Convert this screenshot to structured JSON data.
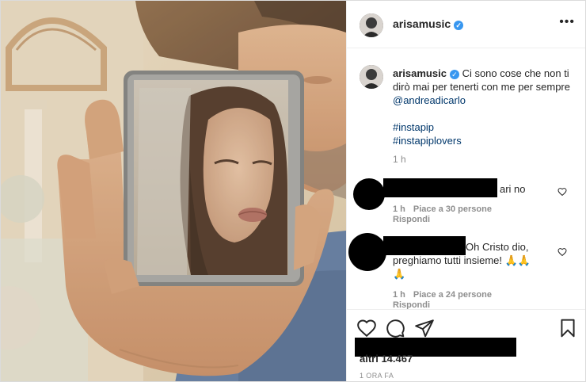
{
  "post": {
    "author": "arisamusic",
    "caption_text": "Ci sono cose che non ti dirò mai per tenerti con me per sempre",
    "mention": "@andreadicarlo",
    "hashtags": [
      "#instapip",
      "#instapiplovers"
    ],
    "caption_time": "1 h"
  },
  "comments": [
    {
      "text": "ari no",
      "time": "1 h",
      "likes": "Piace a 30 persone",
      "reply": "Rispondi"
    },
    {
      "text_line1": "Oh Cristo dio,",
      "text_line2": "preghiamo tutti insieme! 🙏🙏",
      "text_line3": "🙏",
      "time": "1 h",
      "likes": "Piace a 24 persone",
      "reply": "Rispondi"
    }
  ],
  "likes_suffix": "altri 14.467",
  "posted_ago": "1 ORA FA",
  "icons": {
    "more": "more-options-icon",
    "like": "heart-icon",
    "comment": "comment-icon",
    "share": "share-icon",
    "save": "bookmark-icon",
    "verified": "verified-badge-icon"
  },
  "colors": {
    "verified": "#3897f0",
    "link": "#00376b",
    "muted": "#8e8e8e"
  }
}
